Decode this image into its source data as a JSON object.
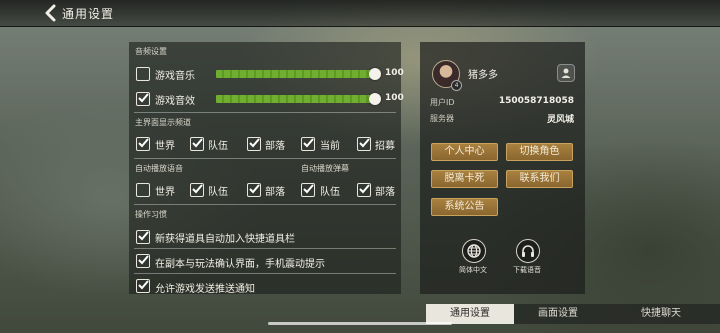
{
  "header": {
    "title": "通用设置"
  },
  "audio": {
    "section_label": "音频设置",
    "items": [
      {
        "label": "游戏音乐",
        "checked": false,
        "value": "100"
      },
      {
        "label": "游戏音效",
        "checked": true,
        "value": "100"
      }
    ]
  },
  "channels": {
    "section_label": "主界面显示频道",
    "items": [
      {
        "label": "世界",
        "checked": true
      },
      {
        "label": "队伍",
        "checked": true
      },
      {
        "label": "部落",
        "checked": true
      },
      {
        "label": "当前",
        "checked": true
      },
      {
        "label": "招募",
        "checked": true
      }
    ]
  },
  "auto_voice": {
    "section_label": "自动播放语音",
    "items": [
      {
        "label": "世界",
        "checked": false
      },
      {
        "label": "队伍",
        "checked": true
      },
      {
        "label": "部落",
        "checked": true
      }
    ]
  },
  "auto_danmaku": {
    "section_label": "自动播放弹幕",
    "items": [
      {
        "label": "队伍",
        "checked": true
      },
      {
        "label": "部落",
        "checked": true
      }
    ]
  },
  "habits": {
    "section_label": "操作习惯",
    "items": [
      {
        "label": "新获得道具自动加入快捷道具栏",
        "checked": true
      },
      {
        "label": "在副本与玩法确认界面，手机震动提示",
        "checked": true
      },
      {
        "label": "允许游戏发送推送通知",
        "checked": true
      }
    ]
  },
  "profile": {
    "name": "猪多多",
    "level_badge": "4",
    "user_id_label": "用户ID",
    "user_id": "150058718058",
    "server_label": "服务器",
    "server": "灵风城"
  },
  "actions": {
    "user_center": "个人中心",
    "switch_role": "切换角色",
    "unstuck": "脱离卡死",
    "contact": "联系我们",
    "notice": "系统公告"
  },
  "shortcuts": {
    "language": "简体中文",
    "voice_download": "下载语音"
  },
  "tabs": [
    {
      "label": "通用设置",
      "active": true
    },
    {
      "label": "画面设置",
      "active": false
    },
    {
      "label": "快捷聊天",
      "active": false
    }
  ],
  "colors": {
    "accent_green": "#6fae2e",
    "button_gold": "#a9813f"
  }
}
